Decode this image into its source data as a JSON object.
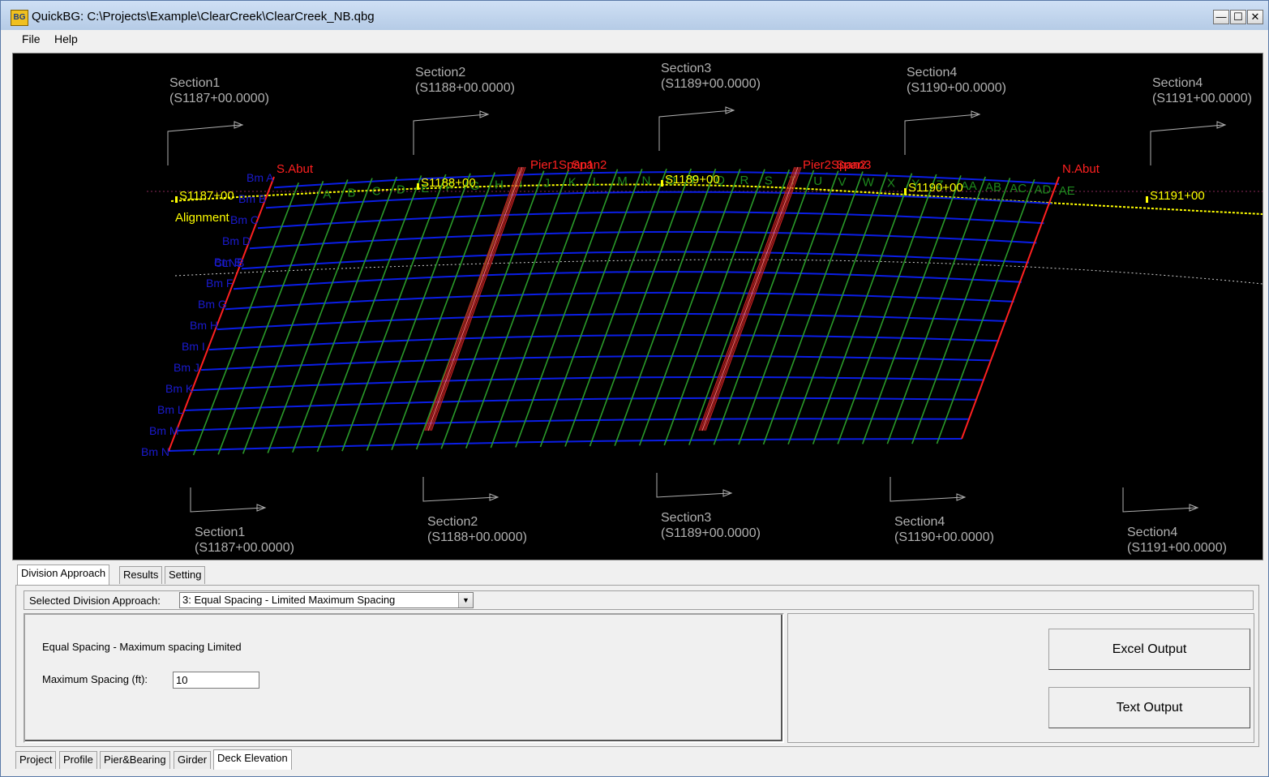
{
  "window": {
    "title": "QuickBG: C:\\Projects\\Example\\ClearCreek\\ClearCreek_NB.qbg",
    "icon_label": "BG",
    "controls": {
      "minimize": "—",
      "maximize": "☐",
      "close": "✕"
    }
  },
  "menu": {
    "file": "File",
    "help": "Help"
  },
  "drawing": {
    "sections_top": [
      {
        "name": "Section1",
        "station": "(S1187+00.0000)"
      },
      {
        "name": "Section2",
        "station": "(S1188+00.0000)"
      },
      {
        "name": "Section3",
        "station": "(S1189+00.0000)"
      },
      {
        "name": "Section4",
        "station": "(S1190+00.0000)"
      },
      {
        "name": "Section4",
        "station": "(S1191+00.0000)"
      }
    ],
    "sections_bottom": [
      {
        "name": "Section1",
        "station": "(S1187+00.0000)"
      },
      {
        "name": "Section2",
        "station": "(S1188+00.0000)"
      },
      {
        "name": "Section3",
        "station": "(S1189+00.0000)"
      },
      {
        "name": "Section4",
        "station": "(S1190+00.0000)"
      },
      {
        "name": "Section4",
        "station": "(S1191+00.0000)"
      }
    ],
    "stations": [
      "S1187+00",
      "S1188+00",
      "S1189+00",
      "S1190+00",
      "S1191+00"
    ],
    "alignment_label": "Alignment",
    "clnb_label": "CLNB",
    "s_abut": "S.Abut",
    "n_abut": "N.Abut",
    "pier1_label": "Pier1Span1",
    "pier1_label2": "Span2",
    "pier2_label": "Pier2Span2",
    "pier2_label2": "Span3",
    "beams": [
      "Bm A",
      "Bm B",
      "Bm C",
      "Bm D",
      "Bm E",
      "Bm F",
      "Bm G",
      "Bm H",
      "Bm I",
      "Bm J",
      "Bm K",
      "Bm L",
      "Bm M",
      "Bm N"
    ],
    "divisions": [
      "A",
      "B",
      "C",
      "D",
      "E",
      "F",
      "G",
      "H",
      "I",
      "J",
      "K",
      "L",
      "M",
      "N",
      "O",
      "P",
      "Q",
      "R",
      "S",
      "T",
      "U",
      "V",
      "W",
      "X",
      "Y",
      "Z",
      "AA",
      "AB",
      "AC",
      "AD",
      "AE"
    ],
    "colors": {
      "beam": "#0a1ee6",
      "division": "#2a9a2a",
      "abut": "#ff2020",
      "alignment": "#ffff00",
      "section": "#b0b0b0",
      "beam_label": "#1a1ad0",
      "division_label": "#1e8a1e"
    }
  },
  "tabs_top": [
    "Division Approach",
    "Results",
    "Setting"
  ],
  "division": {
    "selector_label": "Selected Division Approach:",
    "selected": "3: Equal Spacing - Limited Maximum Spacing",
    "dropdown_arrow": "▼",
    "description": "Equal Spacing - Maximum spacing Limited",
    "max_spacing_label": "Maximum Spacing (ft):",
    "max_spacing_value": "10"
  },
  "buttons": {
    "excel": "Excel Output",
    "text": "Text Output"
  },
  "tabs_bottom": [
    "Project",
    "Profile",
    "Pier&Bearing",
    "Girder",
    "Deck Elevation"
  ]
}
